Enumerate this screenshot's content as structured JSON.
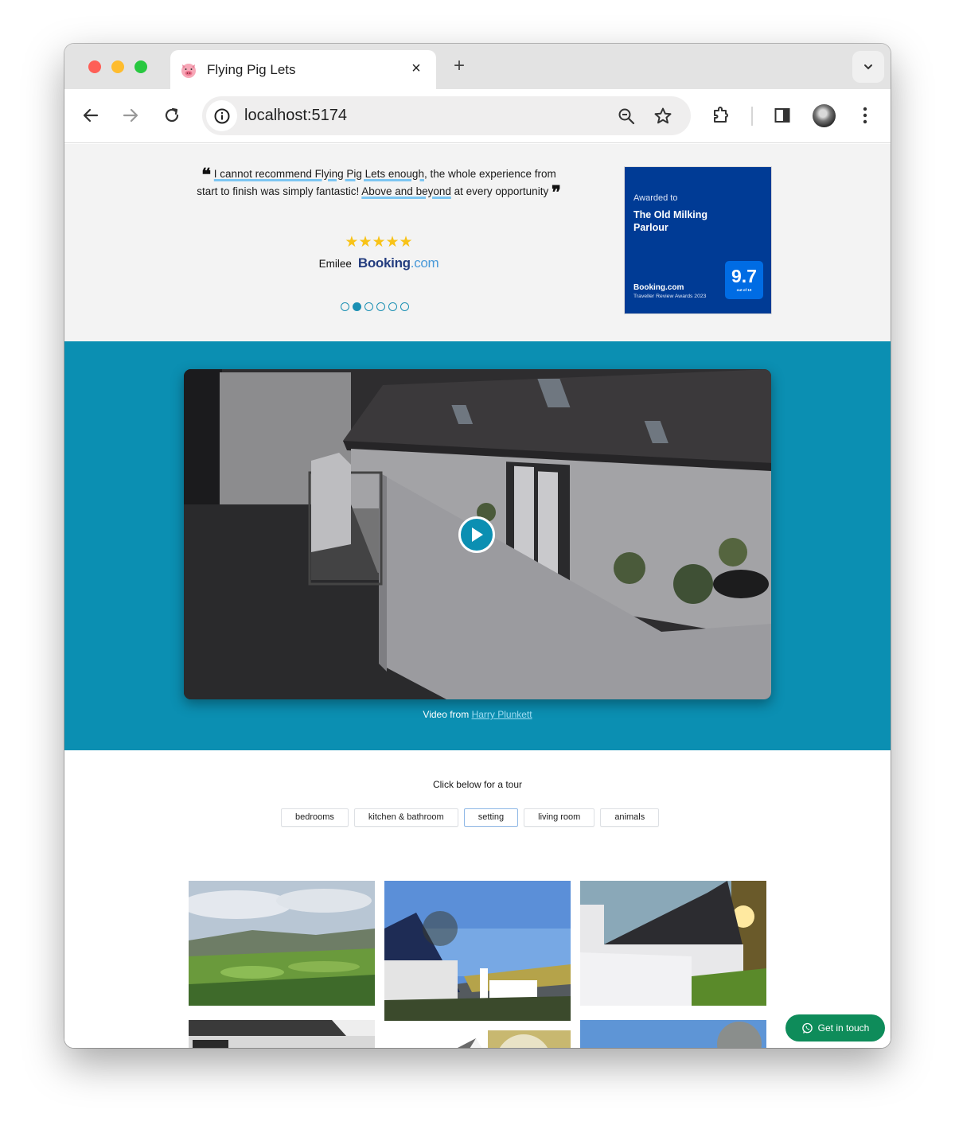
{
  "browser": {
    "tab": {
      "title": "Flying Pig Lets",
      "favicon": "pig-face-icon"
    },
    "new_tab_label": "+",
    "close_tab_label": "×",
    "url": "localhost:5174",
    "icons": [
      "back-icon",
      "forward-icon",
      "reload-icon",
      "site-info-icon",
      "zoom-out-icon",
      "bookmark-star-icon",
      "extensions-icon",
      "side-panel-icon",
      "profile-avatar",
      "more-menu-icon",
      "tab-search-icon"
    ]
  },
  "reviews": {
    "quote_parts": {
      "highlight1": "I cannot recommend Flying Pig Lets enough",
      "text1": ", the whole experience from start to finish was simply fantastic! ",
      "highlight2": "Above and beyond",
      "text2": " at every opportunity"
    },
    "open_quote": "❝",
    "close_quote": "❞",
    "rating_stars": 5,
    "stars_text": "★★★★★",
    "reviewer": "Emilee",
    "source_brand": "Booking",
    "source_tld": ".com",
    "carousel": {
      "total": 6,
      "active_index": 1
    }
  },
  "award": {
    "label": "Awarded to",
    "property": "The Old Milking Parlour",
    "brand": "Booking.com",
    "subtitle": "Traveller Review Awards 2023",
    "score": "9.7",
    "score_sub": "out of 10",
    "colors": {
      "background": "#003b95",
      "score_bg": "#006ce4"
    }
  },
  "video": {
    "credit_prefix": "Video from",
    "credit_author": "Harry Plunkett",
    "section_color": "#0b8fb2"
  },
  "tour": {
    "heading": "Click below for a tour",
    "filters": [
      {
        "label": "bedrooms",
        "active": false
      },
      {
        "label": "kitchen & bathroom",
        "active": false
      },
      {
        "label": "setting",
        "active": true
      },
      {
        "label": "living room",
        "active": false
      },
      {
        "label": "animals",
        "active": false
      }
    ],
    "photos": [
      {
        "subject": "valley view"
      },
      {
        "subject": "cottage and gateway"
      },
      {
        "subject": "cottage at sunset"
      },
      {
        "subject": "cottage black and white"
      },
      {
        "subject": "cottage gable with trees"
      },
      {
        "subject": "cottage roof and sky"
      }
    ]
  },
  "contact_button": {
    "label": "Get in touch",
    "icon": "whatsapp-icon",
    "color": "#0e8c5a"
  }
}
